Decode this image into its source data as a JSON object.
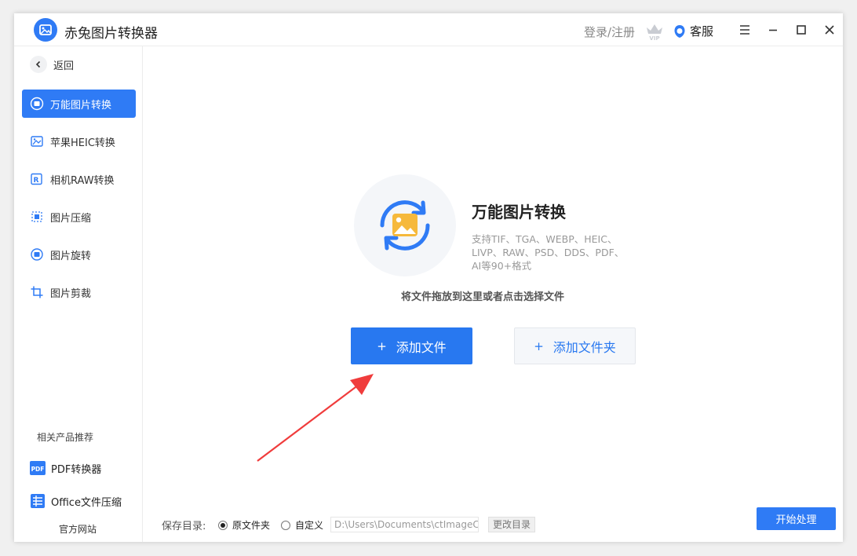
{
  "app": {
    "title": "赤兔图片转换器"
  },
  "header": {
    "login_label": "登录/注册",
    "service_label": "客服"
  },
  "sidebar": {
    "back_label": "返回",
    "items": [
      {
        "label": "万能图片转换",
        "icon": "convert-icon",
        "active": true
      },
      {
        "label": "苹果HEIC转换",
        "icon": "heic-icon"
      },
      {
        "label": "相机RAW转换",
        "icon": "raw-icon"
      },
      {
        "label": "图片压缩",
        "icon": "compress-icon"
      },
      {
        "label": "图片旋转",
        "icon": "rotate-icon"
      },
      {
        "label": "图片剪裁",
        "icon": "crop-icon"
      }
    ],
    "related_title": "相关产品推荐",
    "related": [
      {
        "label": "PDF转换器",
        "icon": "pdf-icon"
      },
      {
        "label": "Office文件压缩",
        "icon": "office-icon"
      }
    ],
    "official_site": "官方网站"
  },
  "main": {
    "title": "万能图片转换",
    "description": "支持TIF、TGA、WEBP、HEIC、LIVP、RAW、PSD、DDS、PDF、AI等90+格式",
    "drop_hint": "将文件拖放到这里或者点击选择文件",
    "add_file_label": "添加文件",
    "add_folder_label": "添加文件夹",
    "plus_glyph": "+"
  },
  "footer": {
    "save_dir_label": "保存目录:",
    "option_original": "原文件夹",
    "option_custom": "自定义",
    "selected_option": "原文件夹",
    "path_value": "D:\\Users\\Documents\\ctImageCo",
    "change_dir_label": "更改目录",
    "start_label": "开始处理"
  },
  "colors": {
    "accent": "#2f7bf5",
    "arrow": "#f03c3c",
    "image_yellow": "#f6b93b"
  }
}
